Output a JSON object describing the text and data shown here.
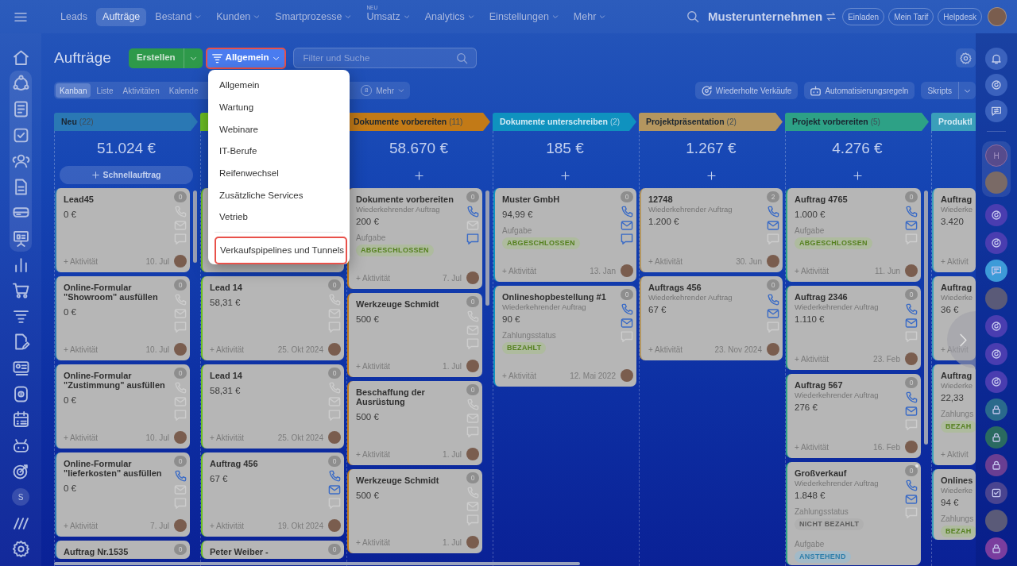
{
  "top_nav": {
    "items": [
      {
        "label": "Leads",
        "selected": false,
        "caret": false
      },
      {
        "label": "Aufträge",
        "selected": true,
        "caret": false
      },
      {
        "label": "Bestand",
        "selected": false,
        "caret": true
      },
      {
        "label": "Kunden",
        "selected": false,
        "caret": true
      },
      {
        "label": "Smartprozesse",
        "selected": false,
        "caret": true
      },
      {
        "label": "Umsatz",
        "selected": false,
        "caret": true,
        "badge": "NEU"
      },
      {
        "label": "Analytics",
        "selected": false,
        "caret": true
      },
      {
        "label": "Einstellungen",
        "selected": false,
        "caret": true
      },
      {
        "label": "Mehr",
        "selected": false,
        "caret": true
      }
    ],
    "company": "Musterunternehmen",
    "buttons": [
      "Einladen",
      "Mein Tarif",
      "Helpdesk"
    ]
  },
  "left_sidebar": {
    "user_initial": "S"
  },
  "right_sidebar": {
    "group_initial": "H"
  },
  "header": {
    "title": "Aufträge",
    "create_button": "Erstellen",
    "pipeline_button": {
      "label": "Allgemein",
      "highlighted": true
    },
    "search": {
      "placeholder": "Filter und Suche"
    }
  },
  "view_tabs": [
    {
      "label": "Kanban",
      "selected": true
    },
    {
      "label": "Liste",
      "selected": false
    },
    {
      "label": "Aktivitäten",
      "selected": false
    },
    {
      "label": "Kalende",
      "selected": false
    }
  ],
  "more_tab": {
    "count": "8",
    "label": "Mehr"
  },
  "toolbar_buttons": [
    {
      "label": "Wiederholte Verkäufe",
      "split": false
    },
    {
      "label": "Automatisierungsregeln",
      "split": false
    },
    {
      "label": "Skripts",
      "split": true
    }
  ],
  "pipeline_menu": {
    "items": [
      "Allgemein",
      "Wartung",
      "Webinare",
      "IT-Berufe",
      "Reifenwechsel",
      "Zusätzliche Services",
      "Vetrieb"
    ],
    "footer_item": {
      "label": "Verkaufspipelines und Tunnels",
      "highlighted": true
    }
  },
  "columns": [
    {
      "title": "Neu",
      "count": "(22)",
      "color": "#2a78b4",
      "total": "51.024 €",
      "quick_add": "Schnellauftrag",
      "cards": [
        {
          "title": "Lead45",
          "amount": "0 €",
          "badge": "0",
          "channels": {
            "phone": false,
            "mail": false,
            "chat": false
          },
          "activity": "+ Aktivität",
          "date": "10. Jul",
          "avatar": true
        },
        {
          "title": "Online-Formular \"Showroom\" ausfüllen",
          "amount": "0 €",
          "badge": "0",
          "channels": {
            "phone": false,
            "mail": false,
            "chat": false
          },
          "activity": "+ Aktivität",
          "date": "10. Jul",
          "avatar": true
        },
        {
          "title": "Online-Formular \"Zustimmung\" ausfüllen",
          "amount": "0 €",
          "badge": "0",
          "channels": {
            "phone": false,
            "mail": false,
            "chat": false
          },
          "activity": "+ Aktivität",
          "date": "10. Jul",
          "avatar": true
        },
        {
          "title": "Online-Formular \"lieferkosten\" ausfüllen",
          "amount": "0 €",
          "badge": "0",
          "channels": {
            "phone": true,
            "mail": false,
            "chat": false
          },
          "activity": "+ Aktivität",
          "date": "7. Jul",
          "avatar": true
        },
        {
          "title": "Auftrag Nr.1535",
          "badge": "0"
        }
      ]
    },
    {
      "color": "#6cbf23",
      "cards": [
        {
          "kind": "covered"
        },
        {
          "kind": "deal",
          "title": "Lead 14",
          "amount": "58,31 €",
          "badge": "0",
          "channels": {
            "phone": false,
            "mail": false,
            "chat": false
          },
          "activity": "+ Aktivität",
          "date": "25. Okt 2024",
          "avatar": true
        },
        {
          "kind": "deal",
          "title": "Lead 14",
          "amount": "58,31 €",
          "badge": "0",
          "channels": {
            "phone": false,
            "mail": false,
            "chat": false
          },
          "activity": "+ Aktivität",
          "date": "25. Okt 2024",
          "avatar": true
        },
        {
          "kind": "deal",
          "title": "Auftrag 456",
          "amount": "67 €",
          "badge": "0",
          "channels": {
            "phone": true,
            "mail": true,
            "chat": false
          },
          "activity": "+ Aktivität",
          "date": "19. Okt 2024",
          "avatar": true
        },
        {
          "kind": "deal",
          "title": "Peter Weiber -",
          "badge": "0"
        }
      ]
    },
    {
      "title": "Dokumente vorbereiten",
      "count": "(11)",
      "color": "#c27a17",
      "total": "58.670 €",
      "add_button": true,
      "cards": [
        {
          "title": "Dokumente vorbereiten",
          "subtitle": "Wiederkehrender Auftrag",
          "amount": "200 €",
          "fields": [
            {
              "label": "Aufgabe",
              "tag": "ABGESCHLOSSEN",
              "color": "#55801f"
            }
          ],
          "badge": "0",
          "channels": {
            "phone": true,
            "mail": false,
            "chat": true
          },
          "activity": "+ Aktivität",
          "date": "7. Jul",
          "avatar": true
        },
        {
          "title": "Werkzeuge Schmidt",
          "amount": "500 €",
          "badge": "0",
          "channels": {
            "phone": false,
            "mail": false,
            "chat": false
          },
          "activity": "+ Aktivität",
          "date": "1. Jul",
          "avatar": true
        },
        {
          "title": "Beschaffung der Ausrüstung",
          "amount": "500 €",
          "badge": "0",
          "channels": {
            "phone": false,
            "mail": false,
            "chat": false
          },
          "activity": "+ Aktivität",
          "date": "1. Jul",
          "avatar": true
        },
        {
          "title": "Werkzeuge Schmidt",
          "amount": "500 €",
          "badge": "0",
          "channels": {
            "phone": false,
            "mail": false,
            "chat": false
          },
          "activity": "+ Aktivität",
          "date": "1. Jul",
          "avatar": true
        }
      ]
    },
    {
      "title": "Dokumente unterschreiben",
      "count": "(2)",
      "color": "#0f92bf",
      "light_text": true,
      "total": "185 €",
      "add_button": true,
      "cards": [
        {
          "title": "Muster GmbH",
          "amount": "94,99 €",
          "fields": [
            {
              "label": "Aufgabe",
              "tag": "ABGESCHLOSSEN",
              "color": "#55801f"
            }
          ],
          "badge": "0",
          "channels": {
            "phone": true,
            "mail": true,
            "chat": true
          },
          "activity": "+ Aktivität",
          "date": "13. Jan",
          "avatar": true
        },
        {
          "title": "Onlineshopbestellung #1",
          "subtitle": "Wiederkehrender Auftrag",
          "amount": "90 €",
          "fields": [
            {
              "label": "Zahlungsstatus",
              "tag": "BEZAHLT",
              "color": "#55801f"
            }
          ],
          "badge": "0",
          "channels": {
            "phone": true,
            "mail": true,
            "chat": false
          },
          "activity": "+ Aktivität",
          "date": "12. Mai 2022",
          "avatar": true
        }
      ]
    },
    {
      "title": "Projektpräsentation",
      "count": "(2)",
      "color": "#b4965f",
      "total": "1.267 €",
      "add_button": true,
      "cards": [
        {
          "title": "12748",
          "subtitle": "Wiederkehrender Auftrag",
          "amount": "1.200 €",
          "badge": "2",
          "channels": {
            "phone": true,
            "mail": true,
            "chat": false
          },
          "activity": "+ Aktivität",
          "date": "30. Jun",
          "avatar": true
        },
        {
          "title": "Auftrags 456",
          "subtitle": "Wiederkehrender Auftrag",
          "amount": "67 €",
          "badge": "0",
          "channels": {
            "phone": true,
            "mail": true,
            "chat": false
          },
          "activity": "+ Aktivität",
          "date": "23. Nov 2024",
          "avatar": true
        }
      ]
    },
    {
      "title": "Projekt vorbereiten",
      "count": "(5)",
      "color": "#2da186",
      "total": "4.276 €",
      "add_button": true,
      "cards": [
        {
          "title": "Auftrag 4765",
          "amount": "1.000 €",
          "fields": [
            {
              "label": "Aufgabe",
              "tag": "ABGESCHLOSSEN",
              "color": "#55801f"
            }
          ],
          "badge": "0",
          "channels": {
            "phone": true,
            "mail": true,
            "chat": false
          },
          "activity": "+ Aktivität",
          "date": "11. Jun",
          "avatar": true
        },
        {
          "title": "Auftrag 2346",
          "subtitle": "Wiederkehrender Auftrag",
          "amount": "1.110 €",
          "badge": "0",
          "channels": {
            "phone": true,
            "mail": true,
            "chat": false
          },
          "activity": "+ Aktivität",
          "date": "23. Feb",
          "avatar": true
        },
        {
          "title": "Auftrag 567",
          "subtitle": "Wiederkehrender Auftrag",
          "amount": "276 €",
          "badge": "0",
          "channels": {
            "phone": true,
            "mail": true,
            "chat": false
          },
          "activity": "+ Aktivität",
          "date": "16. Feb",
          "avatar": true
        },
        {
          "title": "Großverkauf",
          "subtitle": "Wiederkehrender Auftrag",
          "amount": "1.848 €",
          "fields": [
            {
              "label": "Zahlungsstatus",
              "tag": "NICHT BEZAHLT",
              "color": "#5c5c5c"
            },
            {
              "label": "Aufgabe",
              "tag": "ANSTEHEND",
              "color": "#2d7eab"
            }
          ],
          "badge": "0",
          "badge_dot": true,
          "channels": {
            "phone": true,
            "mail": true,
            "chat": false
          }
        }
      ]
    },
    {
      "title": "Produktl",
      "color": "#3a9fba",
      "light_text": true,
      "cards": [
        {
          "title": "Auftrag",
          "subtitle": "Wiederke",
          "amount": "3.420",
          "activity": "+ Aktivit"
        },
        {
          "title": "Auftrag",
          "subtitle": "Wiederke",
          "amount": "36 €",
          "activity": "+ Aktivit"
        },
        {
          "title": "Auftrag",
          "subtitle": "Wiederke",
          "amount": "22,33",
          "fields": [
            {
              "label": "Zahlungs",
              "tag": "BEZAH",
              "color": "#55801f"
            }
          ],
          "activity": "+ Aktivit"
        },
        {
          "title": "Onlines",
          "subtitle": "Wiederke",
          "amount": "94 €",
          "fields": [
            {
              "label": "Zahlungs",
              "tag": "BEZAH",
              "color": "#55801f"
            }
          ]
        }
      ]
    }
  ]
}
